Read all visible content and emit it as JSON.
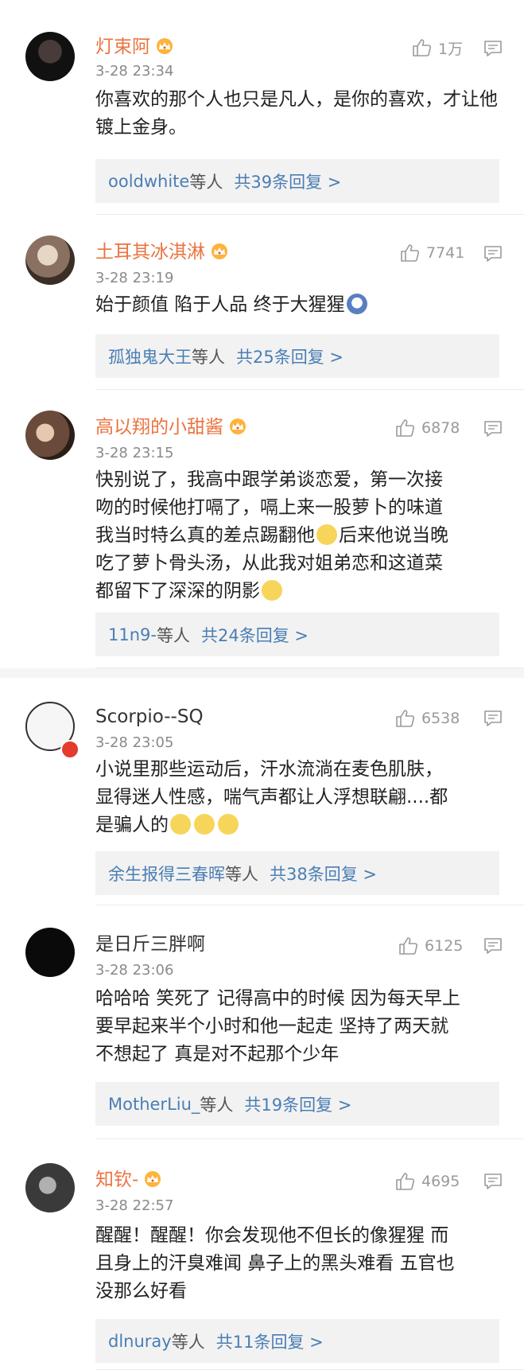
{
  "comments": [
    {
      "username": "灯束阿",
      "vip": true,
      "time": "3-28 23:34",
      "likes": "1万",
      "content": "你喜欢的那个人也只是凡人，是你的喜欢，才让他镀上金身。",
      "reply_users": "ooldwhite",
      "reply_suffix": "等人",
      "reply_count": "共39条回复 >"
    },
    {
      "username": "土耳其冰淇淋",
      "vip": true,
      "time": "3-28 23:19",
      "likes": "7741",
      "content": "始于颜值 陷于人品 终于大猩猩",
      "reply_users": "孤独鬼大王",
      "reply_suffix": "等人",
      "reply_count": "共25条回复 >"
    },
    {
      "username": "高以翔的小甜酱",
      "vip": true,
      "time": "3-28 23:15",
      "likes": "6878",
      "content_lines": [
        "快别说了，我高中跟学弟谈恋爱，第一次接",
        "吻的时候他打嗝了，嗝上来一股萝卜的味道",
        "我当时特么真的差点踢翻他",
        "后来他说当晚",
        "吃了萝卜骨头汤，从此我对姐弟恋和这道菜",
        "都留下了深深的阴影"
      ],
      "reply_users": "11n9-",
      "reply_suffix": "等人",
      "reply_count": "共24条回复 >"
    },
    {
      "username": "Scorpio--SQ",
      "vip": false,
      "time": "3-28 23:05",
      "likes": "6538",
      "content_lines": [
        "小说里那些运动后，汗水流淌在麦色肌肤，",
        "显得迷人性感，喘气声都让人浮想联翩....都",
        "是骗人的"
      ],
      "reply_users": "余生报得三春晖",
      "reply_suffix": "等人",
      "reply_count": "共38条回复 >"
    },
    {
      "username": "是日斤三胖啊",
      "vip": false,
      "time": "3-28 23:06",
      "likes": "6125",
      "content_lines": [
        "哈哈哈 笑死了 记得高中的时候 因为每天早上",
        "要早起来半个小时和他一起走 坚持了两天就",
        "不想起了 真是对不起那个少年"
      ],
      "reply_users": "MotherLiu_",
      "reply_suffix": "等人",
      "reply_count": "共19条回复 >"
    },
    {
      "username": "知钦-",
      "vip": true,
      "time": "3-28 22:57",
      "likes": "4695",
      "content_lines": [
        "醒醒！醒醒！你会发现他不但长的像猩猩 而",
        "且身上的汗臭难闻 鼻子上的黑头难看 五官也",
        "没那么好看"
      ],
      "reply_users": "dlnuray",
      "reply_suffix": "等人",
      "reply_count": "共11条回复 >"
    }
  ],
  "colors": {
    "vip_name": "#eb7340",
    "link": "#4a7eb4",
    "meta": "#8a8a8a",
    "reply_bg": "#f2f2f2"
  },
  "icons": {
    "like": "thumbs-up-icon",
    "reply": "comment-bubble-icon",
    "vip": "crown-badge-icon"
  }
}
